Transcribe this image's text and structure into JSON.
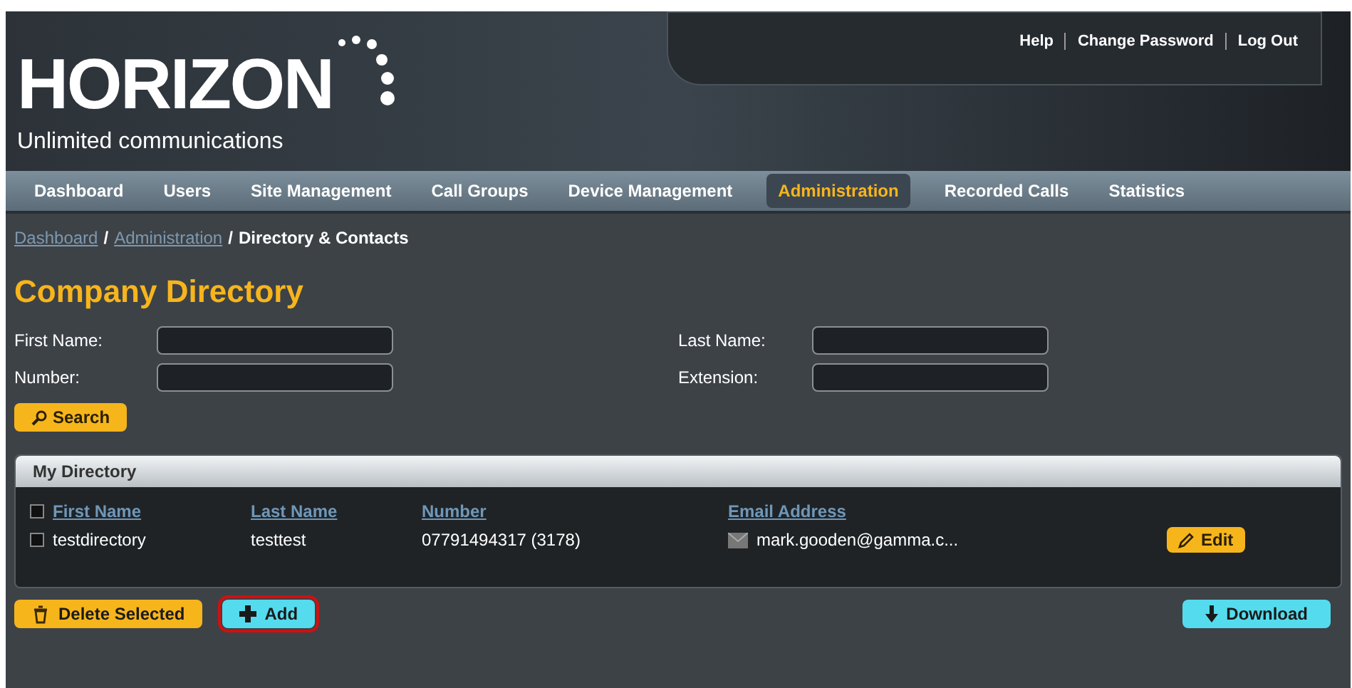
{
  "header": {
    "logo": "HORIZON",
    "tagline": "Unlimited communications",
    "links": [
      "Help",
      "Change Password",
      "Log Out"
    ]
  },
  "nav": [
    {
      "label": "Dashboard",
      "selected": false
    },
    {
      "label": "Users",
      "selected": false
    },
    {
      "label": "Site Management",
      "selected": false
    },
    {
      "label": "Call Groups",
      "selected": false
    },
    {
      "label": "Device Management",
      "selected": false
    },
    {
      "label": "Administration",
      "selected": true
    },
    {
      "label": "Recorded Calls",
      "selected": false
    },
    {
      "label": "Statistics",
      "selected": false
    }
  ],
  "breadcrumb": {
    "links": [
      "Dashboard",
      "Administration"
    ],
    "separator": "/",
    "current": "Directory & Contacts"
  },
  "title": "Company Directory",
  "filters": [
    {
      "label": "First Name:"
    },
    {
      "label": "Last Name:"
    },
    {
      "label": "Number:"
    },
    {
      "label": "Extension:"
    }
  ],
  "search_button": "Search",
  "directory": {
    "title": "My Directory",
    "select_all_checked": false,
    "columns": [
      "First Name",
      "Last Name",
      "Number",
      "Email Address"
    ],
    "rows": [
      {
        "checked": false,
        "cells": [
          "testdirectory",
          "testtest",
          "07791494317 (3178)",
          "mark.gooden@gamma.c..."
        ],
        "edit": "Edit"
      }
    ]
  },
  "actions": [
    {
      "label": "Delete Selected",
      "kind": "delete",
      "color": "#f7b51c",
      "highlighted": false
    },
    {
      "label": "Add",
      "kind": "add",
      "color": "#55dbee",
      "highlighted": true
    }
  ],
  "download": {
    "label": "Download",
    "color": "#55dbee"
  }
}
